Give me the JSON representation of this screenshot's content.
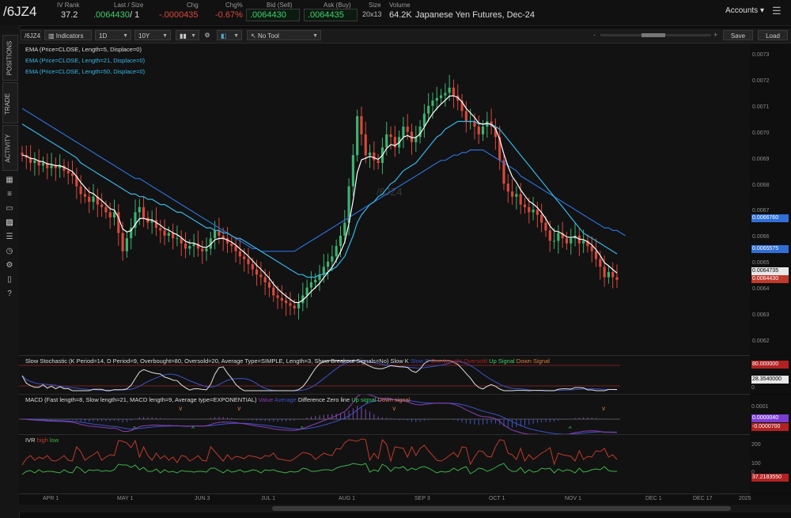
{
  "quote": {
    "symbol": "/6JZ4",
    "ivrank_label": "IV Rank",
    "ivrank": "37.2",
    "last_label": "Last / Size",
    "last": ".0064430",
    "size": "/ 1",
    "chg_label": "Chg",
    "chg": "-.0000435",
    "chgpct_label": "Chg%",
    "chgpct": "-0.67%",
    "bid_label": "Bid (Sell)",
    "bid": ".0064430",
    "ask_label": "Ask (Buy)",
    "ask": ".0064435",
    "sizeq_label": "Size",
    "sizeq": "20x13",
    "volume_label": "Volume",
    "volume": "64.2K",
    "description": "Japanese Yen Futures, Dec-24",
    "accounts": "Accounts"
  },
  "left_tabs": [
    "POSITIONS",
    "TRADE",
    "ACTIVITY"
  ],
  "toolbar": {
    "symbol": "/6JZ4",
    "indicators": "Indicators",
    "interval": "1D",
    "range": "10Y",
    "drawing": "No Tool",
    "save": "Save",
    "load": "Load"
  },
  "studies": {
    "ema5": "EMA (Price=CLOSE, Length=5, Displace=0)",
    "ema21": "EMA (Price=CLOSE, Length=21, Displace=0)",
    "ema50": "EMA (Price=CLOSE, Length=50, Displace=0)",
    "watermark": "/6JZ4",
    "stoch": "Slow Stochastic (K Period=14, D Period=9, Overbought=80, Oversold=20, Average Type=SIMPLE, Length=3, Show Breakout Signals=No)",
    "stoch_legend": [
      "Slow K",
      "Slow D",
      "Overbought",
      "Oversold",
      "Up Signal",
      "Down Signal"
    ],
    "macd": "MACD (Fast length=8, Slow length=21, MACD length=9, Average type=EXPONENTIAL)",
    "macd_legend": [
      "Value",
      "Average",
      "Difference",
      "Zero line",
      "Up signal",
      "Down signal"
    ],
    "ivr": "IVR",
    "ivr_legend": [
      "high",
      "low"
    ]
  },
  "price_axis": {
    "ticks": [
      "0.0073",
      "0.0072",
      "0.0071",
      "0.0070",
      "0.0069",
      "0.0068",
      "0.0067",
      "0.0066",
      "0.0065",
      "0.0064",
      "0.0063",
      "0.0062"
    ],
    "flags": [
      {
        "label": "0.0066760",
        "color": "#2f6fd6"
      },
      {
        "label": "0.0065575",
        "color": "#2f6fd6"
      },
      {
        "label": "0.0064735",
        "color": "#e8e8e8"
      },
      {
        "label": "0.0064430",
        "color": "#c0392b"
      }
    ]
  },
  "stoch_axis": {
    "flags": [
      {
        "label": "80.000000",
        "color": "#b22222"
      },
      {
        "label": "28.3540000",
        "color": "#e8e8e8"
      }
    ],
    "ticks": [
      "0"
    ]
  },
  "macd_axis": {
    "ticks": [
      "0.0001",
      "0"
    ],
    "flags": [
      {
        "label": "0.0000040",
        "color": "#7b3fd0"
      },
      {
        "label": "-0.0000700",
        "color": "#b22222"
      }
    ]
  },
  "ivr_axis": {
    "ticks": [
      "200",
      "100",
      "0"
    ],
    "flags": [
      {
        "label": "37.2183550",
        "color": "#b22222"
      }
    ]
  },
  "time_axis": [
    "APR 1",
    "MAY 1",
    "JUN 3",
    "JUL 1",
    "AUG 1",
    "SEP 3",
    "OCT 1",
    "NOV 1",
    "DEC 1",
    "DEC 17",
    "2025"
  ],
  "colors": {
    "up": "#3cb371",
    "down": "#d9483b",
    "ema5": "#ffffff",
    "ema21": "#37b6e6",
    "ema50": "#2a6fd8"
  },
  "chart_data": {
    "type": "candlestick",
    "instrument": "/6JZ4",
    "ylim": [
      0.00615,
      0.00735
    ],
    "closes": [
      0.00692,
      0.00691,
      0.00689,
      0.0069,
      0.00688,
      0.00689,
      0.00687,
      0.00688,
      0.00687,
      0.00688,
      0.00686,
      0.00685,
      0.00684,
      0.0068,
      0.00677,
      0.00676,
      0.00674,
      0.00676,
      0.00673,
      0.00672,
      0.0067,
      0.00668,
      0.0067,
      0.00662,
      0.00655,
      0.0066,
      0.00664,
      0.0067,
      0.00672,
      0.00668,
      0.00666,
      0.00667,
      0.00664,
      0.00663,
      0.00661,
      0.00662,
      0.0066,
      0.0066,
      0.00658,
      0.00656,
      0.00657,
      0.00658,
      0.00656,
      0.00655,
      0.00656,
      0.0066,
      0.00663,
      0.00661,
      0.0066,
      0.00658,
      0.00657,
      0.00655,
      0.00653,
      0.00652,
      0.0065,
      0.00648,
      0.00646,
      0.00645,
      0.00643,
      0.00641,
      0.00638,
      0.00637,
      0.00636,
      0.00635,
      0.00634,
      0.00633,
      0.00635,
      0.00638,
      0.00641,
      0.00643,
      0.00644,
      0.00646,
      0.00649,
      0.00651,
      0.00653,
      0.00657,
      0.00661,
      0.00666,
      0.0068,
      0.00692,
      0.00707,
      0.007,
      0.00692,
      0.00693,
      0.0069,
      0.00689,
      0.00695,
      0.007,
      0.00699,
      0.00695,
      0.00699,
      0.00703,
      0.00701,
      0.00697,
      0.00699,
      0.00703,
      0.00708,
      0.00711,
      0.00713,
      0.00714,
      0.00715,
      0.00716,
      0.00718,
      0.00715,
      0.00713,
      0.00709,
      0.00705,
      0.00705,
      0.00703,
      0.007,
      0.00703,
      0.00705,
      0.00703,
      0.00699,
      0.0069,
      0.00681,
      0.00678,
      0.00676,
      0.00677,
      0.00673,
      0.00672,
      0.0067,
      0.00671,
      0.00669,
      0.00666,
      0.00663,
      0.00659,
      0.00659,
      0.00662,
      0.0066,
      0.00658,
      0.0066,
      0.00661,
      0.00658,
      0.00659,
      0.00657,
      0.00655,
      0.00652,
      0.00649,
      0.00645,
      0.00647,
      0.00645,
      0.00644
    ],
    "ema21": [
      0.00704,
      0.00703,
      0.00702,
      0.00701,
      0.007,
      0.00699,
      0.00698,
      0.00697,
      0.00696,
      0.00695,
      0.00694,
      0.00693,
      0.00692,
      0.00691,
      0.00689,
      0.00688,
      0.00687,
      0.00686,
      0.00685,
      0.00684,
      0.00683,
      0.00682,
      0.00681,
      0.0068,
      0.00679,
      0.00678,
      0.00677,
      0.00677,
      0.00676,
      0.00676,
      0.00675,
      0.00675,
      0.00674,
      0.00673,
      0.00673,
      0.00672,
      0.00671,
      0.0067,
      0.0067,
      0.00669,
      0.00668,
      0.00667,
      0.00666,
      0.00665,
      0.00664,
      0.00664,
      0.00663,
      0.00663,
      0.00662,
      0.00662,
      0.00661,
      0.0066,
      0.0066,
      0.00659,
      0.00658,
      0.00657,
      0.00656,
      0.00655,
      0.00654,
      0.00653,
      0.00652,
      0.00651,
      0.0065,
      0.00649,
      0.00648,
      0.00647,
      0.00646,
      0.00646,
      0.00645,
      0.00645,
      0.00645,
      0.00646,
      0.00646,
      0.00647,
      0.00648,
      0.00649,
      0.00651,
      0.00653,
      0.00657,
      0.00661,
      0.00666,
      0.00669,
      0.00671,
      0.00673,
      0.00674,
      0.00676,
      0.00677,
      0.00679,
      0.00681,
      0.00682,
      0.00684,
      0.00686,
      0.00687,
      0.00688,
      0.00689,
      0.00691,
      0.00693,
      0.00695,
      0.00697,
      0.00699,
      0.007,
      0.00702,
      0.00703,
      0.00704,
      0.00705,
      0.00705,
      0.00705,
      0.00705,
      0.00705,
      0.00704,
      0.00704,
      0.00704,
      0.00704,
      0.00703,
      0.00702,
      0.007,
      0.00698,
      0.00696,
      0.00694,
      0.00692,
      0.0069,
      0.00688,
      0.00686,
      0.00684,
      0.00682,
      0.0068,
      0.00678,
      0.00676,
      0.00674,
      0.00672,
      0.0067,
      0.00668,
      0.00666,
      0.00664,
      0.00662,
      0.00661,
      0.0066,
      0.00659,
      0.00658,
      0.00657,
      0.00656,
      0.00655,
      0.00654
    ],
    "ema50": [
      0.0071,
      0.00709,
      0.00708,
      0.00707,
      0.00706,
      0.00705,
      0.00704,
      0.00703,
      0.00702,
      0.00701,
      0.007,
      0.00699,
      0.00698,
      0.00697,
      0.00696,
      0.00695,
      0.00694,
      0.00693,
      0.00692,
      0.00691,
      0.0069,
      0.00689,
      0.00688,
      0.00687,
      0.00686,
      0.00685,
      0.00684,
      0.00683,
      0.00683,
      0.00682,
      0.00681,
      0.0068,
      0.00679,
      0.00678,
      0.00677,
      0.00676,
      0.00675,
      0.00674,
      0.00673,
      0.00672,
      0.00671,
      0.0067,
      0.00669,
      0.00668,
      0.00667,
      0.00666,
      0.00665,
      0.00664,
      0.00663,
      0.00662,
      0.00661,
      0.0066,
      0.00659,
      0.00658,
      0.00657,
      0.00656,
      0.00656,
      0.00655,
      0.00655,
      0.00655,
      0.00655,
      0.00655,
      0.00655,
      0.00655,
      0.00655,
      0.00655,
      0.00656,
      0.00657,
      0.00658,
      0.00659,
      0.0066,
      0.00661,
      0.00662,
      0.00663,
      0.00664,
      0.00665,
      0.00666,
      0.00667,
      0.00668,
      0.00669,
      0.0067,
      0.00671,
      0.00672,
      0.00673,
      0.00674,
      0.00675,
      0.00676,
      0.00677,
      0.00678,
      0.00679,
      0.0068,
      0.00681,
      0.00682,
      0.00683,
      0.00684,
      0.00685,
      0.00686,
      0.00687,
      0.00688,
      0.00689,
      0.0069,
      0.0069,
      0.00691,
      0.00692,
      0.00692,
      0.00693,
      0.00693,
      0.00694,
      0.00694,
      0.00694,
      0.00694,
      0.00693,
      0.00692,
      0.00691,
      0.0069,
      0.00689,
      0.00688,
      0.00687,
      0.00686,
      0.00684,
      0.00683,
      0.00682,
      0.00681,
      0.0068,
      0.00679,
      0.00678,
      0.00677,
      0.00676,
      0.00675,
      0.00674,
      0.00673,
      0.00672,
      0.00671,
      0.0067,
      0.00669,
      0.00668,
      0.00667,
      0.00666,
      0.00665,
      0.00664,
      0.00664,
      0.00663,
      0.00663,
      0.00662,
      0.00661
    ]
  }
}
